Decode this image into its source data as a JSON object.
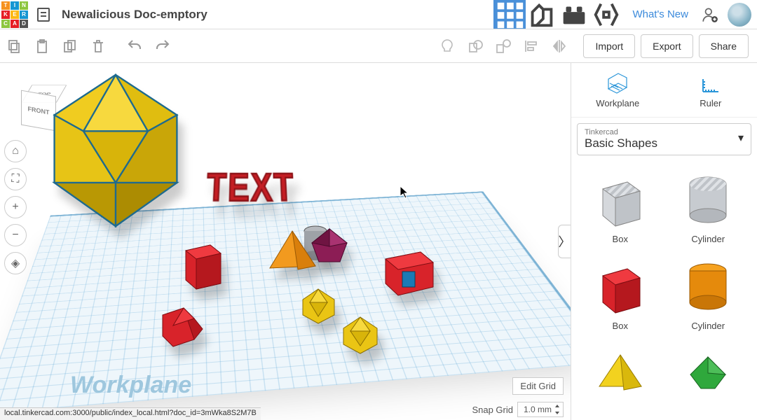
{
  "header": {
    "doc_title": "Newalicious Doc-emptory",
    "whats_new": "What's New",
    "logo_cells": [
      "T",
      "I",
      "N",
      "K",
      "E",
      "R",
      "C",
      "A",
      "D"
    ]
  },
  "toolbar": {
    "import": "Import",
    "export": "Export",
    "share": "Share"
  },
  "sidebar": {
    "workplane": "Workplane",
    "ruler": "Ruler",
    "selector_small": "Tinkercad",
    "selector_big": "Basic Shapes",
    "shapes": [
      {
        "label": "Box",
        "kind": "box-hole"
      },
      {
        "label": "Cylinder",
        "kind": "cyl-hole"
      },
      {
        "label": "Box",
        "kind": "box-red"
      },
      {
        "label": "Cylinder",
        "kind": "cyl-orange"
      },
      {
        "label": "",
        "kind": "pyramid-yellow"
      },
      {
        "label": "",
        "kind": "poly-green"
      }
    ]
  },
  "canvas": {
    "workplane_label": "Workplane",
    "text3d": "TEXT",
    "edit_grid": "Edit Grid",
    "snap_grid_label": "Snap Grid",
    "snap_grid_value": "1.0 mm",
    "viewcube_top": "TOP",
    "viewcube_front": "FRONT"
  },
  "status": {
    "url": "local.tinkercad.com:3000/public/index_local.html?doc_id=3mWka8S2M7B"
  }
}
